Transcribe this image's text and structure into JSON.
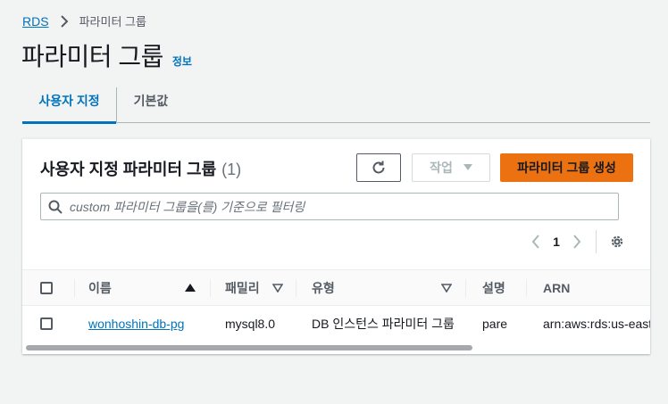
{
  "breadcrumb": {
    "root": "RDS",
    "current": "파라미터 그룹"
  },
  "page": {
    "title": "파라미터 그룹",
    "info_link": "정보"
  },
  "tabs": [
    {
      "label": "사용자 지정",
      "selected": true
    },
    {
      "label": "기본값",
      "selected": false
    }
  ],
  "panel": {
    "title": "사용자 지정 파라미터 그룹",
    "count": "(1)",
    "actions_label": "작업",
    "create_label": "파라미터 그룹 생성",
    "search_placeholder": "custom 파라미터 그룹을(를) 기준으로 필터링"
  },
  "pagination": {
    "current_page": "1"
  },
  "table": {
    "columns": [
      "이름",
      "패밀리",
      "유형",
      "설명",
      "ARN"
    ],
    "rows": [
      {
        "name": "wonhoshin-db-pg",
        "family": "mysql8.0",
        "type": "DB 인스턴스 파라미터 그룹",
        "description": "pare",
        "arn": "arn:aws:rds:us-east"
      }
    ]
  },
  "colors": {
    "link": "#0073bb",
    "primary_button": "#ec7211",
    "text": "#16191f",
    "muted": "#545b64",
    "background": "#f2f3f3"
  },
  "icons": {
    "breadcrumb_separator": "chevron-right-icon",
    "refresh": "refresh-icon",
    "actions_caret": "caret-down-icon",
    "search": "search-icon",
    "prev": "chevron-left-icon",
    "next": "chevron-right-icon",
    "settings": "gear-icon",
    "sort_asc": "sort-ascending-icon",
    "sort_none": "sort-descending-outline-icon"
  }
}
